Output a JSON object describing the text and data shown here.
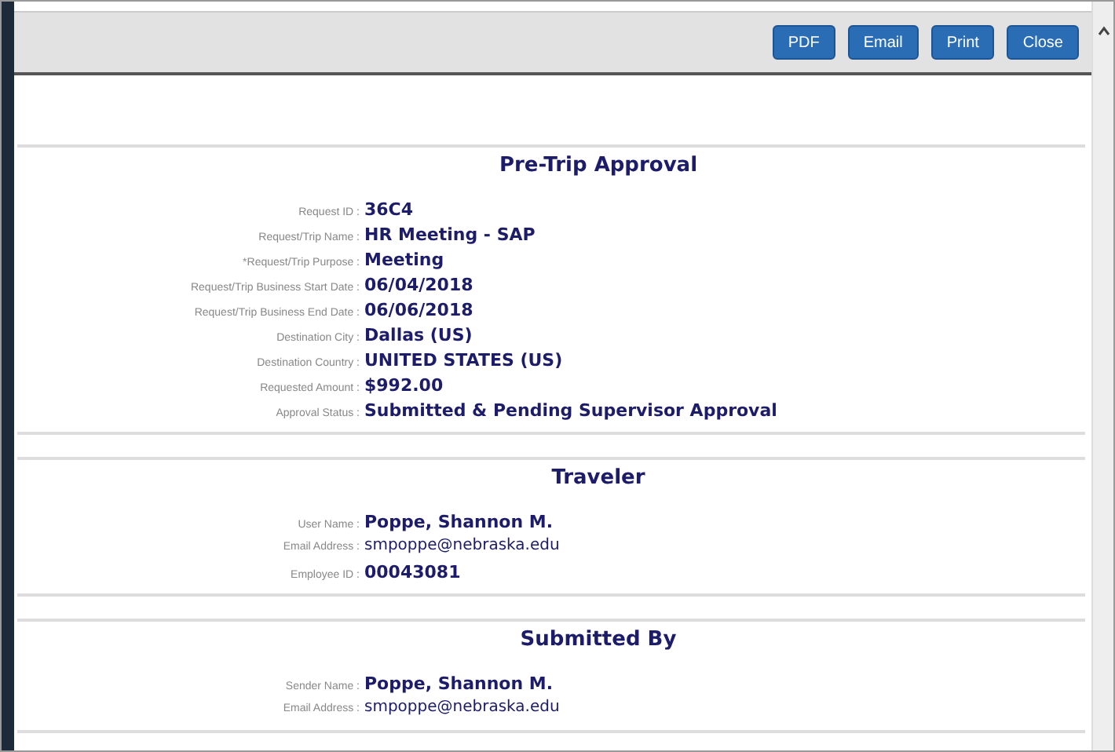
{
  "toolbar": {
    "buttons": [
      "PDF",
      "Email",
      "Print",
      "Close"
    ]
  },
  "sections": [
    {
      "title": "Pre-Trip Approval",
      "rows": [
        {
          "label": "Request ID :",
          "value": "36C4",
          "kind": "strong"
        },
        {
          "label": "Request/Trip Name :",
          "value": "HR Meeting - SAP",
          "kind": "strong"
        },
        {
          "label": "*Request/Trip Purpose :",
          "value": "Meeting",
          "kind": "strong"
        },
        {
          "label": "Request/Trip Business Start Date :",
          "value": "06/04/2018",
          "kind": "strong"
        },
        {
          "label": "Request/Trip Business End Date :",
          "value": "06/06/2018",
          "kind": "strong"
        },
        {
          "label": "Destination City :",
          "value": "Dallas (US)",
          "kind": "strong"
        },
        {
          "label": "Destination Country :",
          "value": "UNITED STATES (US)",
          "kind": "strong"
        },
        {
          "label": "Requested Amount :",
          "value": "$992.00",
          "kind": "strong"
        },
        {
          "label": "Approval Status :",
          "value": "Submitted & Pending Supervisor Approval",
          "kind": "strong"
        }
      ]
    },
    {
      "title": "Traveler",
      "rows": [
        {
          "label": "User Name :",
          "value": "Poppe, Shannon M.",
          "kind": "strong"
        },
        {
          "label": "Email Address :",
          "value": "smpoppe@nebraska.edu",
          "kind": "plain"
        },
        {
          "label": "Employee ID :",
          "value": "00043081",
          "kind": "strong"
        }
      ]
    },
    {
      "title": "Submitted By",
      "rows": [
        {
          "label": "Sender Name :",
          "value": "Poppe, Shannon M.",
          "kind": "strong"
        },
        {
          "label": "Email Address :",
          "value": "smpoppe@nebraska.edu",
          "kind": "plain"
        }
      ]
    }
  ]
}
